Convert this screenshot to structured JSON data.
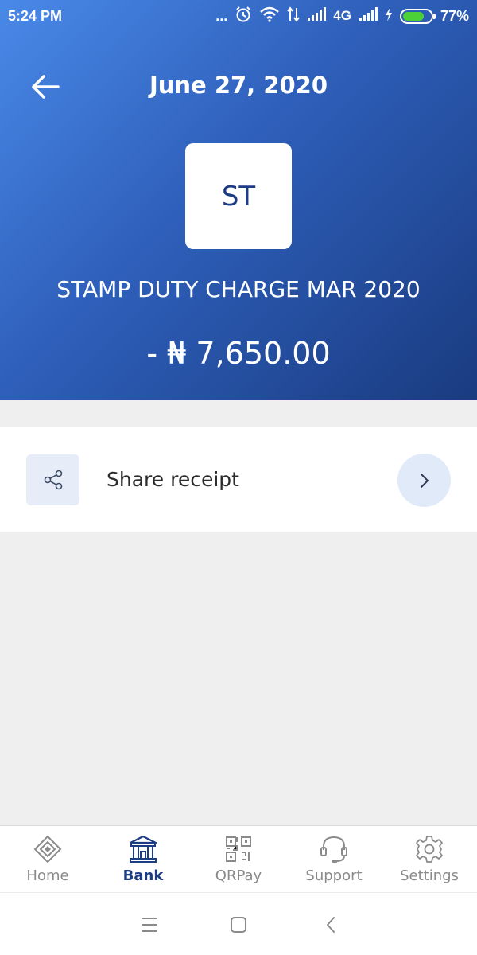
{
  "status_bar": {
    "time": "5:24 PM",
    "dots": "...",
    "network": "4G",
    "battery": "77%",
    "battery_level": 0.77,
    "battery_color": "#4cd137"
  },
  "header": {
    "title": "June 27, 2020",
    "avatar_initials": "ST",
    "description": "STAMP DUTY CHARGE MAR 2020",
    "amount": "- ₦ 7,650.00",
    "gradient_start": "#4a89e8",
    "gradient_end": "#1a3b80"
  },
  "share": {
    "label": "Share receipt",
    "icon": "share-icon",
    "action_icon": "chevron-right-icon"
  },
  "tabs": [
    {
      "label": "Home",
      "icon": "home-icon",
      "active": false
    },
    {
      "label": "Bank",
      "icon": "bank-icon",
      "active": true
    },
    {
      "label": "QRPay",
      "icon": "qr-code-icon",
      "active": false
    },
    {
      "label": "Support",
      "icon": "headset-icon",
      "active": false
    },
    {
      "label": "Settings",
      "icon": "gear-icon",
      "active": false
    }
  ],
  "colors": {
    "brand": "#1c3c83",
    "inactive": "#8a8a8a",
    "page_background": "#efefef"
  }
}
